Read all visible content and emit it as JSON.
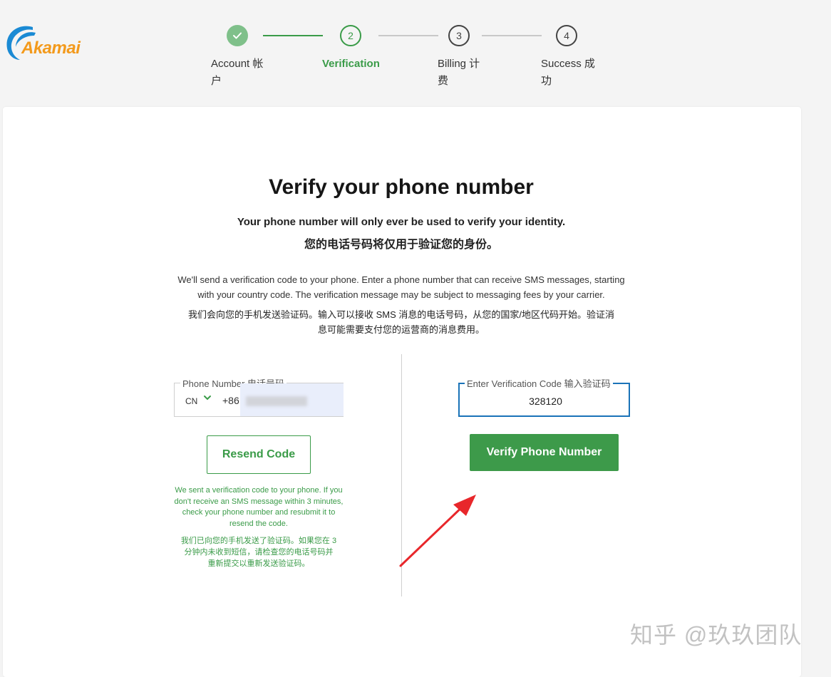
{
  "logo": {
    "text": "Akamai"
  },
  "stepper": {
    "steps": [
      {
        "number": "1",
        "label_line1": "Account 帐",
        "label_line2": "户",
        "state": "done"
      },
      {
        "number": "2",
        "label_line1": "Verification",
        "label_line2": "",
        "state": "active"
      },
      {
        "number": "3",
        "label_line1": "Billing 计",
        "label_line2": "费",
        "state": "todo"
      },
      {
        "number": "4",
        "label_line1": "Success 成",
        "label_line2": "功",
        "state": "todo"
      }
    ],
    "checkmark_icon": "check-icon"
  },
  "main": {
    "title": "Verify your phone number",
    "subtitle_en": "Your phone number will only ever be used to verify your identity.",
    "subtitle_cn": "您的电话号码将仅用于验证您的身份。",
    "desc_en_1": "We'll send a verification code to your phone. Enter a phone number that can receive SMS messages, starting",
    "desc_en_2": "with your country code. The verification message may be subject to messaging fees by your carrier.",
    "desc_cn_1": "我们会向您的手机发送验证码。输入可以接收 SMS 消息的电话号码，从您的国家/地区代码开始。验证消",
    "desc_cn_2": "息可能需要支付您的运营商的消息费用。"
  },
  "phone": {
    "label": "Phone Number 电话号码",
    "country": "CN",
    "prefix": "+86",
    "value": ""
  },
  "resend": {
    "button_label": "Resend Code",
    "note_en_1": "We sent a verification code to your phone. If you",
    "note_en_2": "don't receive an SMS message within 3 minutes,",
    "note_en_3": "check your phone number and resubmit it to",
    "note_en_4": "resend the code.",
    "note_cn_1": "我们已向您的手机发送了验证码。如果您在 3",
    "note_cn_2": "分钟内未收到短信，请检查您的电话号码并",
    "note_cn_3": "重新提交以重新发送验证码。"
  },
  "verification": {
    "label": "Enter Verification Code 输入验证码",
    "value": "328120",
    "button_label": "Verify Phone Number"
  },
  "watermark": {
    "text": "知乎 @玖玖团队"
  },
  "colors": {
    "brand_orange": "#f39a1c",
    "brand_blue": "#1a8ad4",
    "accent_green": "#3a9b48",
    "focus_blue": "#1a73b8",
    "arrow_red": "#e8272b"
  }
}
